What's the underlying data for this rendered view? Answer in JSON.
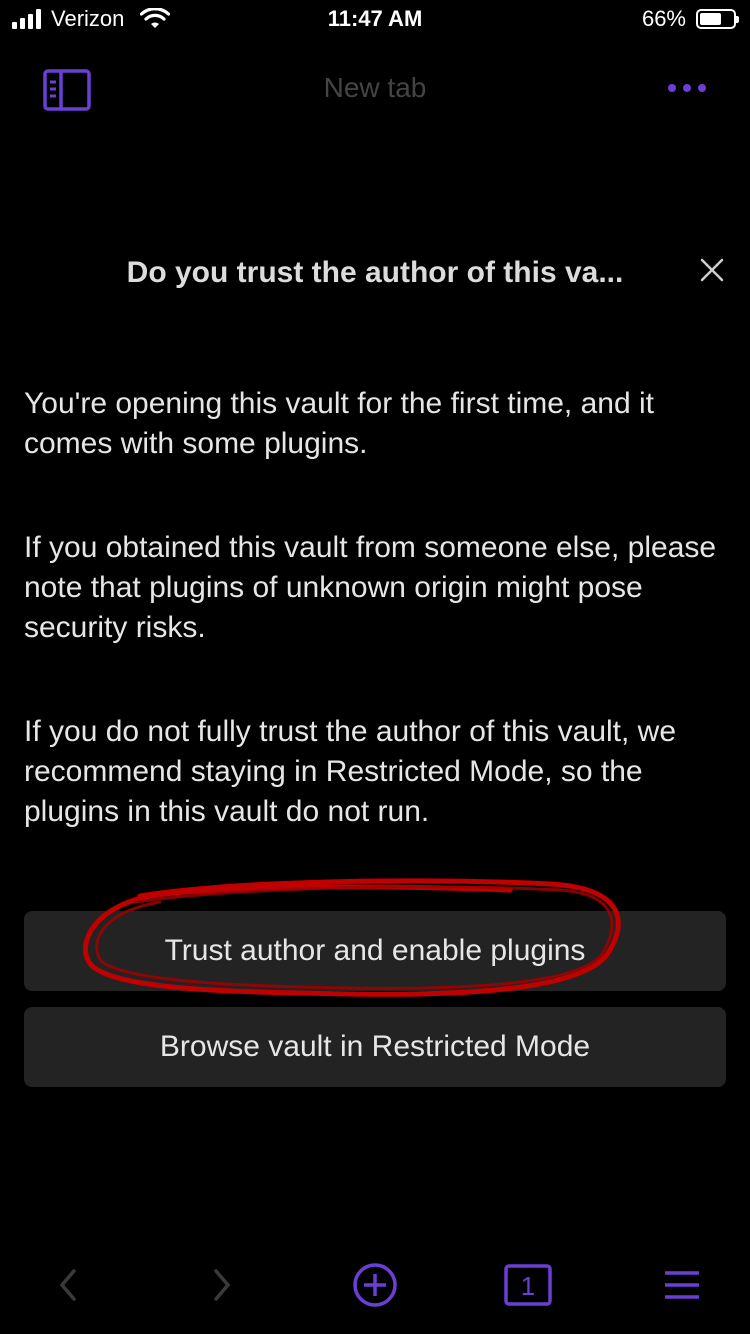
{
  "status_bar": {
    "carrier": "Verizon",
    "time": "11:47 AM",
    "battery_percent": "66%",
    "battery_level": 0.66
  },
  "nav": {
    "tab_title": "New tab",
    "sidebar_icon": "sidebar-toggle-icon",
    "more_icon": "more-horizontal-icon"
  },
  "dialog": {
    "title": "Do you trust the author of this va...",
    "paragraphs": [
      "You're opening this vault for the first time, and it comes with some plugins.",
      "If you obtained this vault from someone else, please note that plugins of unknown origin might pose security risks.",
      "If you do not fully trust the author of this vault, we recommend staying in Restricted Mode, so the plugins in this vault do not run."
    ],
    "trust_button": "Trust author and enable plugins",
    "restricted_button": "Browse vault in Restricted Mode"
  },
  "toolbar": {
    "tab_count": "1",
    "icons": [
      "back-icon",
      "forward-icon",
      "new-tab-icon",
      "tab-switcher-icon",
      "menu-icon"
    ]
  },
  "colors": {
    "accent": "#6b3fd4",
    "annotation": "#c00000",
    "button_bg": "#232323",
    "background": "#000000"
  }
}
